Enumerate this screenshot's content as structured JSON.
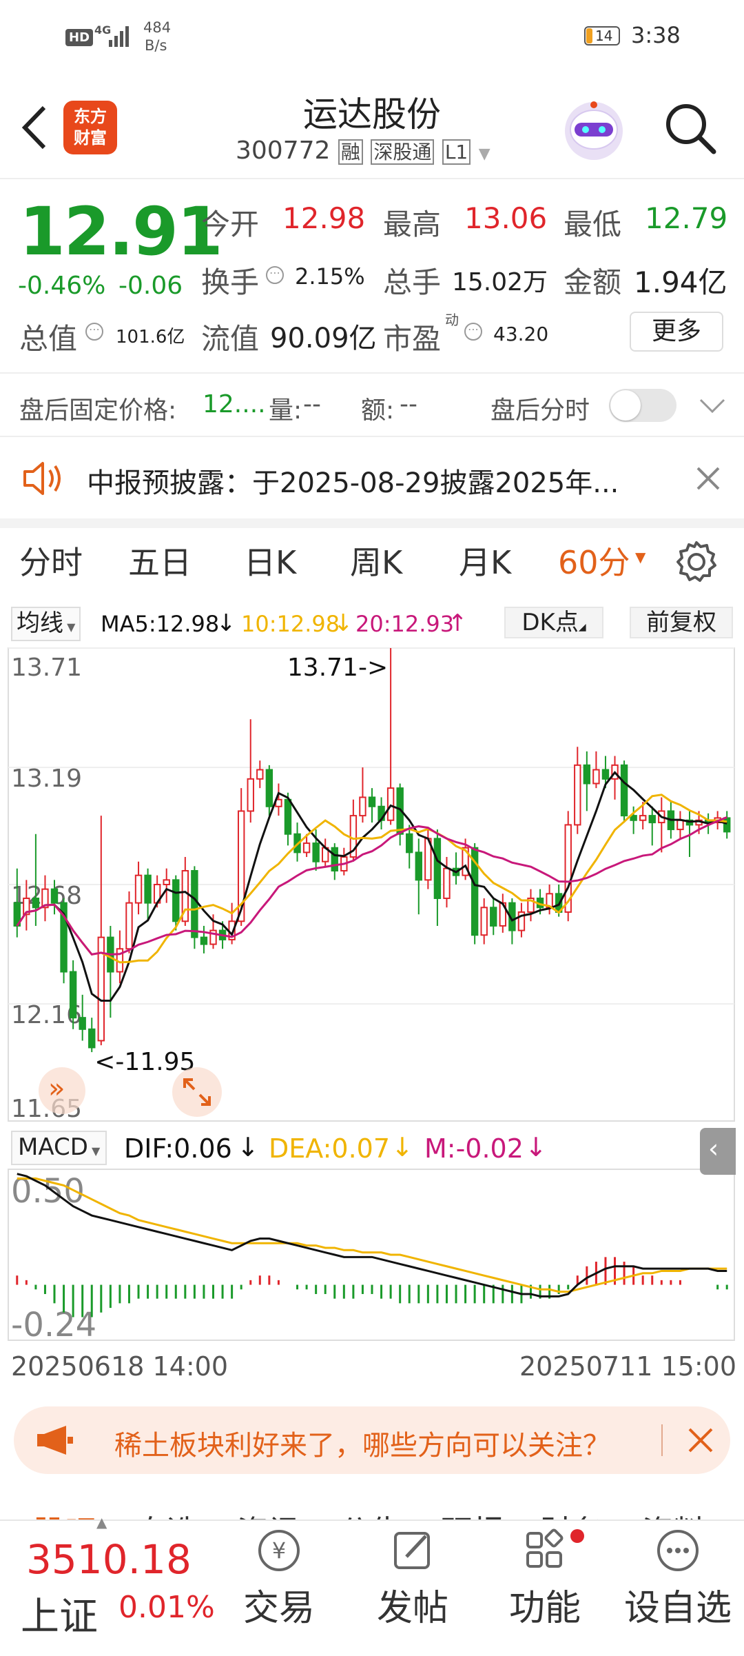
{
  "status_bar": {
    "network": "HD",
    "signal": "4G",
    "speed_value": "484",
    "speed_unit": "B/s",
    "battery": "14",
    "time": "3:38"
  },
  "header": {
    "logo_line1": "东方",
    "logo_line2": "财富",
    "title": "运达股份",
    "code": "300772",
    "tag_rong": "融",
    "tag_sgt": "深股通",
    "tag_l1": "L1"
  },
  "quote": {
    "price": "12.91",
    "change_pct": "-0.46%",
    "change": "-0.06",
    "open_label": "今开",
    "open": "12.98",
    "high_label": "最高",
    "high": "13.06",
    "low_label": "最低",
    "low": "12.79",
    "turnover_label": "换手",
    "turnover": "2.15%",
    "volume_label": "总手",
    "volume": "15.02万",
    "amount_label": "金额",
    "amount": "1.94亿",
    "mcap_label": "总值",
    "mcap": "101.6亿",
    "float_label": "流值",
    "float": "90.09亿",
    "pe_label": "市盈",
    "pe_sup": "动",
    "pe": "43.20",
    "more": "更多"
  },
  "after_hours": {
    "price_label": "盘后固定价格:",
    "price": "12....",
    "vol_label": "量:",
    "vol": "--",
    "amt_label": "额:",
    "amt": "--",
    "toggle_label": "盘后分时"
  },
  "notice": {
    "text": "中报预披露：于2025-08-29披露2025年..."
  },
  "tabs": [
    "分时",
    "五日",
    "日K",
    "周K",
    "月K",
    "60分"
  ],
  "ma_bar": {
    "selector": "均线",
    "ma5": "MA5:12.98",
    "ma10": "10:12.98",
    "ma20": "20:12.93",
    "dk": "DK点",
    "fq": "前复权"
  },
  "colors": {
    "red": "#e0252b",
    "green": "#1a9a2a",
    "orange": "#e2611a",
    "ma5": "#111111",
    "ma10": "#f0b400",
    "ma20": "#c8187a"
  },
  "chart_data": [
    {
      "type": "candlestick",
      "title": "60分",
      "y_ticks": [
        "13.71",
        "13.19",
        "12.68",
        "12.16",
        "11.65"
      ],
      "ylim": [
        11.65,
        13.71
      ],
      "annotations": {
        "max": "13.71->",
        "min": "<-11.95"
      },
      "x_start": "20250618 14:00",
      "x_end": "20250711 15:00",
      "candles": [
        [
          12.6,
          12.5,
          12.75,
          12.45
        ],
        [
          12.55,
          12.62,
          12.7,
          12.48
        ],
        [
          12.62,
          12.58,
          12.9,
          12.5
        ],
        [
          12.58,
          12.66,
          12.72,
          12.52
        ],
        [
          12.66,
          12.6,
          12.7,
          12.55
        ],
        [
          12.6,
          12.3,
          12.62,
          12.25
        ],
        [
          12.3,
          12.1,
          12.35,
          12.05
        ],
        [
          12.1,
          12.05,
          12.2,
          12.0
        ],
        [
          12.05,
          11.97,
          12.1,
          11.95
        ],
        [
          12.0,
          12.45,
          12.98,
          11.98
        ],
        [
          12.45,
          12.3,
          12.5,
          12.1
        ],
        [
          12.3,
          12.4,
          12.48,
          12.25
        ],
        [
          12.4,
          12.6,
          12.65,
          12.38
        ],
        [
          12.6,
          12.72,
          12.78,
          12.55
        ],
        [
          12.72,
          12.6,
          12.75,
          12.52
        ],
        [
          12.6,
          12.68,
          12.72,
          12.58
        ],
        [
          12.68,
          12.7,
          12.75,
          12.6
        ],
        [
          12.7,
          12.52,
          12.72,
          12.48
        ],
        [
          12.52,
          12.74,
          12.8,
          12.5
        ],
        [
          12.74,
          12.45,
          12.76,
          12.4
        ],
        [
          12.45,
          12.42,
          12.5,
          12.38
        ],
        [
          12.42,
          12.48,
          12.55,
          12.4
        ],
        [
          12.48,
          12.44,
          12.52,
          12.4
        ],
        [
          12.44,
          12.52,
          12.6,
          12.42
        ],
        [
          12.52,
          13.0,
          13.1,
          12.5
        ],
        [
          13.0,
          13.14,
          13.4,
          12.95
        ],
        [
          13.14,
          13.18,
          13.22,
          13.1
        ],
        [
          13.18,
          13.02,
          13.2,
          12.98
        ],
        [
          13.02,
          13.05,
          13.12,
          12.98
        ],
        [
          13.05,
          12.9,
          13.08,
          12.85
        ],
        [
          12.9,
          12.82,
          12.95,
          12.78
        ],
        [
          12.82,
          12.86,
          12.9,
          12.8
        ],
        [
          12.86,
          12.78,
          12.92,
          12.74
        ],
        [
          12.78,
          12.84,
          12.88,
          12.76
        ],
        [
          12.84,
          12.74,
          12.86,
          12.7
        ],
        [
          12.74,
          12.8,
          12.84,
          12.72
        ],
        [
          12.8,
          12.98,
          13.05,
          12.78
        ],
        [
          12.98,
          13.06,
          13.19,
          12.95
        ],
        [
          13.06,
          13.02,
          13.1,
          12.95
        ],
        [
          13.02,
          12.96,
          13.06,
          12.92
        ],
        [
          12.96,
          13.1,
          13.71,
          12.94
        ],
        [
          13.1,
          12.9,
          13.12,
          12.85
        ],
        [
          12.9,
          12.82,
          12.94,
          12.75
        ],
        [
          12.82,
          12.7,
          12.88,
          12.55
        ],
        [
          12.7,
          12.88,
          12.92,
          12.66
        ],
        [
          12.88,
          12.62,
          12.92,
          12.5
        ],
        [
          12.62,
          12.75,
          12.8,
          12.58
        ],
        [
          12.75,
          12.72,
          12.82,
          12.68
        ],
        [
          12.72,
          12.84,
          12.88,
          12.7
        ],
        [
          12.84,
          12.46,
          12.86,
          12.42
        ],
        [
          12.46,
          12.58,
          12.62,
          12.42
        ],
        [
          12.58,
          12.5,
          12.62,
          12.46
        ],
        [
          12.5,
          12.6,
          12.64,
          12.47
        ],
        [
          12.6,
          12.48,
          12.62,
          12.42
        ],
        [
          12.48,
          12.56,
          12.6,
          12.45
        ],
        [
          12.56,
          12.62,
          12.66,
          12.52
        ],
        [
          12.62,
          12.58,
          12.66,
          12.55
        ],
        [
          12.58,
          12.64,
          12.68,
          12.55
        ],
        [
          12.64,
          12.56,
          12.68,
          12.54
        ],
        [
          12.56,
          12.94,
          13.0,
          12.52
        ],
        [
          12.94,
          13.2,
          13.28,
          12.9
        ],
        [
          13.2,
          13.12,
          13.26,
          13.0
        ],
        [
          13.12,
          13.18,
          13.26,
          13.1
        ],
        [
          13.18,
          13.14,
          13.24,
          13.1
        ],
        [
          13.14,
          13.2,
          13.24,
          13.05
        ],
        [
          13.2,
          12.98,
          13.22,
          12.95
        ],
        [
          12.98,
          12.96,
          13.02,
          12.9
        ],
        [
          12.96,
          12.98,
          13.04,
          12.92
        ],
        [
          12.98,
          12.95,
          13.02,
          12.85
        ],
        [
          12.95,
          13.0,
          13.06,
          12.82
        ],
        [
          13.0,
          12.92,
          13.04,
          12.88
        ],
        [
          12.92,
          12.96,
          13.0,
          12.88
        ],
        [
          12.96,
          12.94,
          13.0,
          12.8
        ],
        [
          12.94,
          12.96,
          13.0,
          12.9
        ],
        [
          12.96,
          12.95,
          12.99,
          12.9
        ],
        [
          12.95,
          12.97,
          13.0,
          12.92
        ],
        [
          12.97,
          12.91,
          13.0,
          12.88
        ]
      ]
    },
    {
      "type": "macd",
      "selector": "MACD",
      "dif": "DIF:0.06",
      "dea": "DEA:0.07",
      "m": "M:-0.02",
      "y_ticks": [
        "0.50",
        "-0.24"
      ],
      "ylim": [
        -0.24,
        0.5
      ],
      "dif_values": [
        0.48,
        0.47,
        0.45,
        0.43,
        0.4,
        0.37,
        0.34,
        0.32,
        0.3,
        0.29,
        0.28,
        0.27,
        0.26,
        0.25,
        0.24,
        0.23,
        0.22,
        0.21,
        0.2,
        0.19,
        0.18,
        0.17,
        0.16,
        0.15,
        0.17,
        0.19,
        0.2,
        0.2,
        0.19,
        0.18,
        0.17,
        0.16,
        0.15,
        0.14,
        0.13,
        0.12,
        0.12,
        0.12,
        0.12,
        0.11,
        0.1,
        0.09,
        0.08,
        0.07,
        0.06,
        0.05,
        0.04,
        0.03,
        0.02,
        0.01,
        0.0,
        -0.01,
        -0.02,
        -0.03,
        -0.04,
        -0.04,
        -0.05,
        -0.05,
        -0.05,
        -0.04,
        0.0,
        0.03,
        0.05,
        0.07,
        0.08,
        0.08,
        0.08,
        0.07,
        0.07,
        0.07,
        0.07,
        0.07,
        0.07,
        0.07,
        0.07,
        0.06,
        0.06
      ],
      "dea_values": [
        0.46,
        0.46,
        0.46,
        0.45,
        0.44,
        0.43,
        0.41,
        0.39,
        0.37,
        0.35,
        0.33,
        0.31,
        0.3,
        0.28,
        0.27,
        0.26,
        0.25,
        0.24,
        0.23,
        0.22,
        0.21,
        0.2,
        0.19,
        0.18,
        0.18,
        0.18,
        0.18,
        0.18,
        0.18,
        0.18,
        0.18,
        0.17,
        0.17,
        0.16,
        0.16,
        0.15,
        0.15,
        0.14,
        0.14,
        0.14,
        0.13,
        0.13,
        0.12,
        0.11,
        0.1,
        0.09,
        0.08,
        0.07,
        0.06,
        0.05,
        0.04,
        0.03,
        0.02,
        0.01,
        0.0,
        -0.01,
        -0.02,
        -0.02,
        -0.03,
        -0.03,
        -0.02,
        -0.01,
        0.0,
        0.01,
        0.02,
        0.03,
        0.04,
        0.05,
        0.05,
        0.06,
        0.06,
        0.06,
        0.07,
        0.07,
        0.07,
        0.07,
        0.07
      ]
    }
  ],
  "promo": {
    "text": "稀土板块利好来了，哪些方向可以关注？"
  },
  "section_tabs_partial": [
    "股吧",
    "自选",
    "资讯",
    "公告",
    "研报",
    "财务",
    "资料"
  ],
  "bottom_bar": {
    "index_value": "3510.18",
    "index_name": "上证",
    "index_change": "0.01%",
    "trade": "交易",
    "post": "发帖",
    "func": "功能",
    "add": "设自选"
  }
}
